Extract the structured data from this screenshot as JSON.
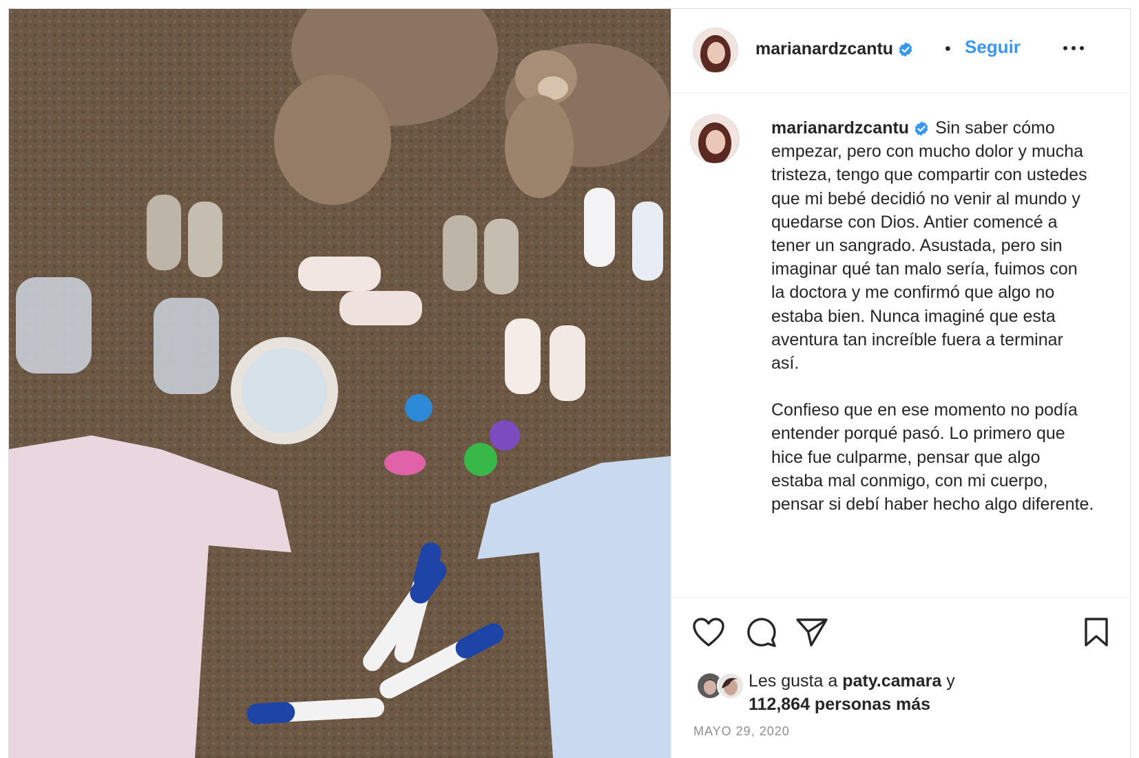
{
  "header": {
    "username": "marianardzcantu",
    "separator": "•",
    "follow_label": "Seguir"
  },
  "caption": {
    "username": "marianardzcantu",
    "paragraph1": "Sin saber cómo empezar, pero con mucho dolor y mucha tristeza, tengo que compartir con ustedes que mi bebé decidió no venir al mundo y quedarse con Dios. Antier comencé a tener un sangrado. Asustada, pero sin imaginar qué tan malo sería, fuimos con la doctora y me confirmó que algo no estaba bien. Nunca imaginé que esta aventura tan increíble fuera a terminar así.",
    "paragraph2": "Confieso que en ese momento no podía entender porqué pasó. Lo primero que hice fue culparme, pensar que algo estaba mal conmigo, con mi cuerpo, pensar si debí haber hecho algo diferente."
  },
  "likes": {
    "prefix": "Les gusta a",
    "user": "paty.camara",
    "conjunction": "y",
    "count_text": "112,864 personas más"
  },
  "date": "MAYO 29, 2020",
  "icons": {
    "like": "heart-icon",
    "comment": "comment-icon",
    "share": "paper-plane-icon",
    "save": "bookmark-icon",
    "more": "more-options-icon",
    "verified": "verified-badge-icon"
  },
  "colors": {
    "accent": "#3897f0",
    "text": "#262626",
    "muted": "#8e8e8e",
    "verified": "#3897f0"
  }
}
